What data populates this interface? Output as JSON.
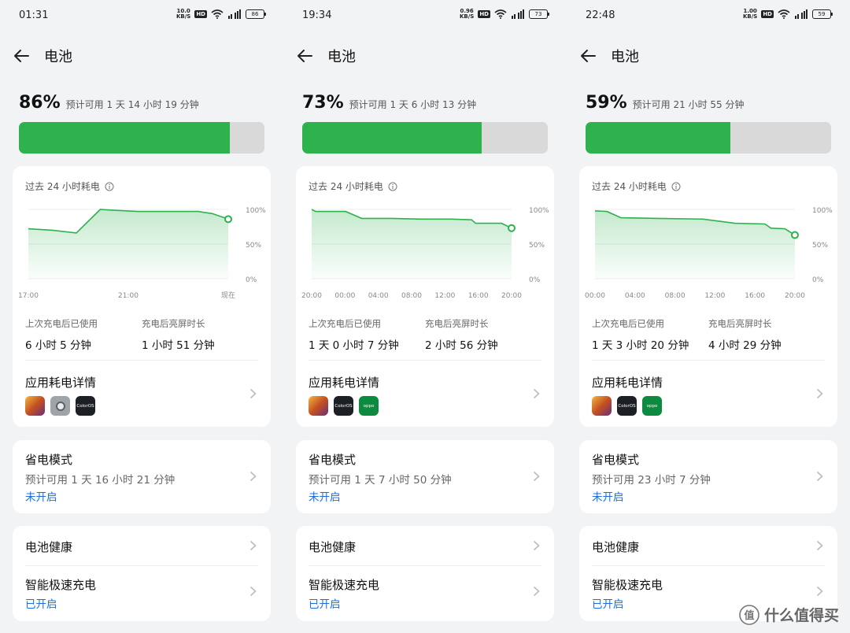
{
  "screens": [
    {
      "time": "01:31",
      "net_speed": [
        "10.0",
        "KB/S"
      ],
      "hd": "HD",
      "battery_indicator": "86",
      "title": "电池",
      "percent_label": "86%",
      "percent_value": 86,
      "estimate": "预计可用 1 天 14 小时 19 分钟",
      "chart_title": "过去 24 小时耗电",
      "chart_data": {
        "type": "area",
        "title": "过去 24 小时耗电",
        "x_labels": [
          "17:00",
          "21:00",
          "现在"
        ],
        "y_labels": [
          "100%",
          "50%",
          "0%"
        ],
        "ylim": [
          0,
          100
        ],
        "x": [
          0,
          0.12,
          0.24,
          0.36,
          0.42,
          0.55,
          0.7,
          0.85,
          0.92,
          1.0
        ],
        "values": [
          72,
          70,
          66,
          100,
          99,
          97,
          97,
          97,
          94,
          86
        ],
        "color": "#2eb24d"
      },
      "stats": [
        {
          "label": "上次充电后已使用",
          "value": "6 小时 5 分钟"
        },
        {
          "label": "充电后亮屏时长",
          "value": "1 小时 51 分钟"
        }
      ],
      "app_detail_title": "应用耗电详情",
      "apps": [
        "game-icon",
        "camera-icon",
        "coloros-icon"
      ],
      "app_text": {
        "coloros": "ColorOS",
        "oppo": "oppo"
      },
      "saver_title": "省电模式",
      "saver_estimate": "预计可用 1 天 16 小时 21 分钟",
      "saver_status": "未开启",
      "health_title": "电池健康",
      "fast_charge_title": "智能极速充电",
      "fast_charge_status": "已开启"
    },
    {
      "time": "19:34",
      "net_speed": [
        "0.96",
        "KB/S"
      ],
      "hd": "HD",
      "battery_indicator": "73",
      "title": "电池",
      "percent_label": "73%",
      "percent_value": 73,
      "estimate": "预计可用 1 天 6 小时 13 分钟",
      "chart_title": "过去 24 小时耗电",
      "chart_data": {
        "type": "area",
        "title": "过去 24 小时耗电",
        "x_labels": [
          "20:00",
          "00:00",
          "04:00",
          "08:00",
          "12:00",
          "16:00",
          "20:00"
        ],
        "y_labels": [
          "100%",
          "50%",
          "0%"
        ],
        "ylim": [
          0,
          100
        ],
        "x": [
          0,
          0.02,
          0.17,
          0.25,
          0.4,
          0.55,
          0.7,
          0.8,
          0.82,
          0.95,
          1.0
        ],
        "values": [
          100,
          97,
          97,
          87,
          87,
          86,
          86,
          85,
          80,
          80,
          73
        ],
        "color": "#2eb24d"
      },
      "stats": [
        {
          "label": "上次充电后已使用",
          "value": "1 天 0 小时 7 分钟"
        },
        {
          "label": "充电后亮屏时长",
          "value": "2 小时 56 分钟"
        }
      ],
      "app_detail_title": "应用耗电详情",
      "apps": [
        "game-icon",
        "coloros-icon",
        "oppo-icon"
      ],
      "app_text": {
        "coloros": "ColorOS",
        "oppo": "oppo"
      },
      "saver_title": "省电模式",
      "saver_estimate": "预计可用 1 天 7 小时 50 分钟",
      "saver_status": "未开启",
      "health_title": "电池健康",
      "fast_charge_title": "智能极速充电",
      "fast_charge_status": "已开启"
    },
    {
      "time": "22:48",
      "net_speed": [
        "1.00",
        "KB/S"
      ],
      "hd": "HD",
      "battery_indicator": "59",
      "title": "电池",
      "percent_label": "59%",
      "percent_value": 59,
      "estimate": "预计可用 21 小时 55 分钟",
      "chart_title": "过去 24 小时耗电",
      "chart_data": {
        "type": "area",
        "title": "过去 24 小时耗电",
        "x_labels": [
          "00:00",
          "04:00",
          "08:00",
          "12:00",
          "16:00",
          "20:00"
        ],
        "y_labels": [
          "100%",
          "50%",
          "0%"
        ],
        "ylim": [
          0,
          100
        ],
        "x": [
          0,
          0.06,
          0.13,
          0.32,
          0.54,
          0.7,
          0.85,
          0.88,
          0.95,
          1.0
        ],
        "values": [
          98,
          97,
          88,
          87,
          86,
          80,
          79,
          73,
          72,
          63
        ],
        "color": "#2eb24d"
      },
      "stats": [
        {
          "label": "上次充电后已使用",
          "value": "1 天 3 小时 20 分钟"
        },
        {
          "label": "充电后亮屏时长",
          "value": "4 小时 29 分钟"
        }
      ],
      "app_detail_title": "应用耗电详情",
      "apps": [
        "game-icon",
        "coloros-icon",
        "oppo-icon"
      ],
      "app_text": {
        "coloros": "ColorOS",
        "oppo": "oppo"
      },
      "saver_title": "省电模式",
      "saver_estimate": "预计可用 23 小时 7 分钟",
      "saver_status": "未开启",
      "health_title": "电池健康",
      "fast_charge_title": "智能极速充电",
      "fast_charge_status": "已开启"
    }
  ],
  "watermark": "什么值得买",
  "colors": {
    "accent_green": "#2eb24d",
    "link_blue": "#1d6fe0",
    "track_gray": "#d9d9da"
  }
}
